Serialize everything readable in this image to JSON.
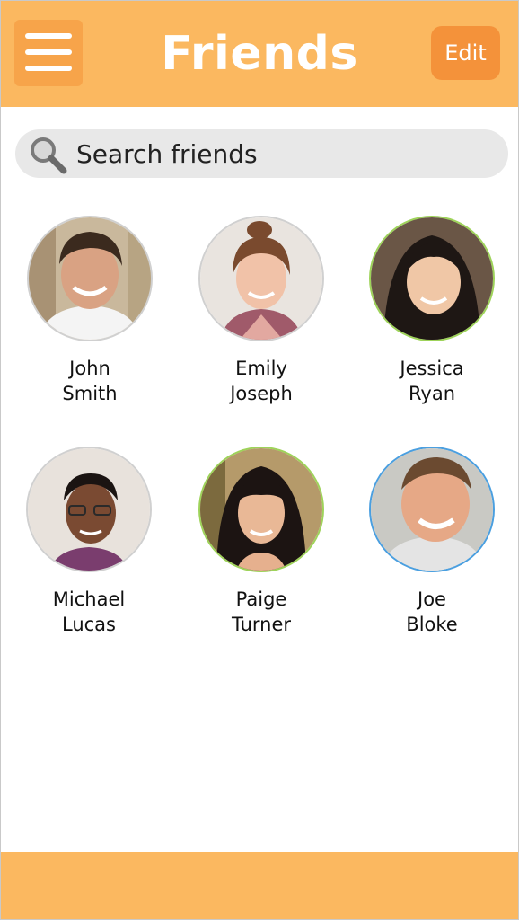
{
  "header": {
    "title": "Friends",
    "edit_label": "Edit",
    "menu_icon": "hamburger-menu-icon"
  },
  "search": {
    "placeholder": "Search friends",
    "icon": "search-icon"
  },
  "friends": [
    {
      "first": "John",
      "last": "Smith",
      "ring": "#d0d0d0"
    },
    {
      "first": "Emily",
      "last": "Joseph",
      "ring": "#d0d0d0"
    },
    {
      "first": "Jessica",
      "last": "Ryan",
      "ring": "#9ed35a"
    },
    {
      "first": "Michael",
      "last": "Lucas",
      "ring": "#d0d0d0"
    },
    {
      "first": "Paige",
      "last": "Turner",
      "ring": "#9ed35a"
    },
    {
      "first": "Joe",
      "last": "Bloke",
      "ring": "#4a9fe0"
    }
  ],
  "colors": {
    "accent": "#fbb860",
    "accent_dark": "#f4923a",
    "search_bg": "#e8e8e8"
  }
}
